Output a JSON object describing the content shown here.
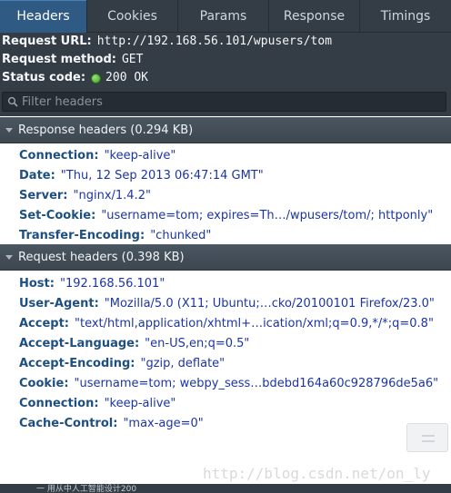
{
  "tabs": [
    {
      "label": "Headers"
    },
    {
      "label": "Cookies"
    },
    {
      "label": "Params"
    },
    {
      "label": "Response"
    },
    {
      "label": "Timings"
    }
  ],
  "request_info": {
    "url_label": "Request URL:",
    "url_value": "http://192.168.56.101/wpusers/tom",
    "method_label": "Request method:",
    "method_value": "GET",
    "status_label": "Status code:",
    "status_value": "200 OK",
    "status_color": "#3c9d24"
  },
  "filter": {
    "placeholder": "Filter headers",
    "value": ""
  },
  "response_headers": {
    "title": "Response headers (0.294 KB)",
    "rows": [
      {
        "key": "Connection:",
        "value": "\"keep-alive\""
      },
      {
        "key": "Date:",
        "value": "\"Thu, 12 Sep 2013 06:47:14 GMT\""
      },
      {
        "key": "Server:",
        "value": "\"nginx/1.4.2\""
      },
      {
        "key": "Set-Cookie:",
        "value": "\"username=tom; expires=Th…/wpusers/tom/; httponly\""
      },
      {
        "key": "Transfer-Encoding:",
        "value": "\"chunked\""
      }
    ]
  },
  "request_headers": {
    "title": "Request headers (0.398 KB)",
    "rows": [
      {
        "key": "Host:",
        "value": "\"192.168.56.101\""
      },
      {
        "key": "User-Agent:",
        "value": "\"Mozilla/5.0 (X11; Ubuntu;…cko/20100101 Firefox/23.0\""
      },
      {
        "key": "Accept:",
        "value": "\"text/html,application/xhtml+…ication/xml;q=0.9,*/*;q=0.8\""
      },
      {
        "key": "Accept-Language:",
        "value": "\"en-US,en;q=0.5\""
      },
      {
        "key": "Accept-Encoding:",
        "value": "\"gzip, deflate\""
      },
      {
        "key": "Cookie:",
        "value": "\"username=tom; webpy_sess…bdebd164a60c928796de5a6\""
      },
      {
        "key": "Connection:",
        "value": "\"keep-alive\""
      },
      {
        "key": "Cache-Control:",
        "value": "\"max-age=0\""
      }
    ]
  },
  "watermark": "http://blog.csdn.net/on_ly",
  "bottom_text": "一 用从中人工智能设计200",
  "colors": {
    "toolbar_bg": "#343c45",
    "active_tab": "#2f5a84",
    "header_key": "#1d4f80",
    "header_value": "#1b35a6"
  }
}
